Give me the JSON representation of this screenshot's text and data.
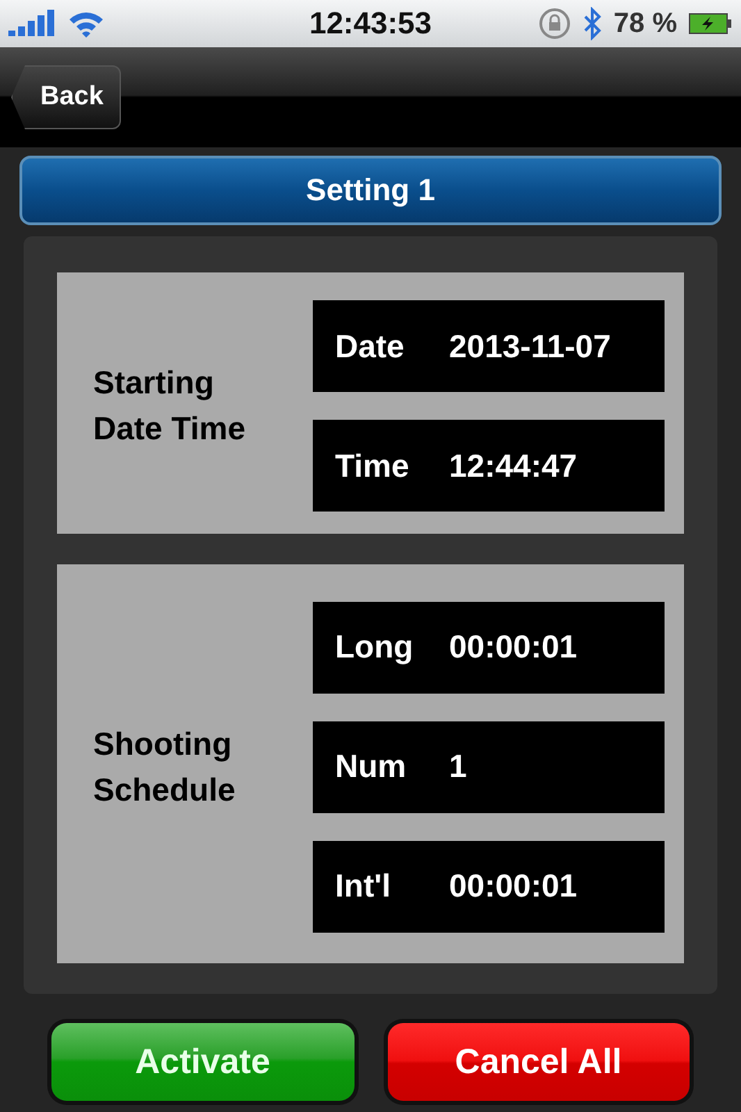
{
  "status_bar": {
    "time": "12:43:53",
    "battery": "78 %"
  },
  "nav": {
    "back": "Back"
  },
  "header": {
    "title": "Setting 1"
  },
  "sections": [
    {
      "label": "Starting\nDate Time",
      "fields": [
        {
          "label": "Date",
          "value": "2013-11-07"
        },
        {
          "label": "Time",
          "value": "12:44:47"
        }
      ]
    },
    {
      "label": "Shooting\nSchedule",
      "fields": [
        {
          "label": "Long",
          "value": "00:00:01"
        },
        {
          "label": "Num",
          "value": "1"
        },
        {
          "label": "Int'l",
          "value": "00:00:01"
        }
      ]
    }
  ],
  "buttons": [
    {
      "label": "Activate",
      "kind": "confirm"
    },
    {
      "label": "Cancel All",
      "kind": "danger"
    }
  ]
}
